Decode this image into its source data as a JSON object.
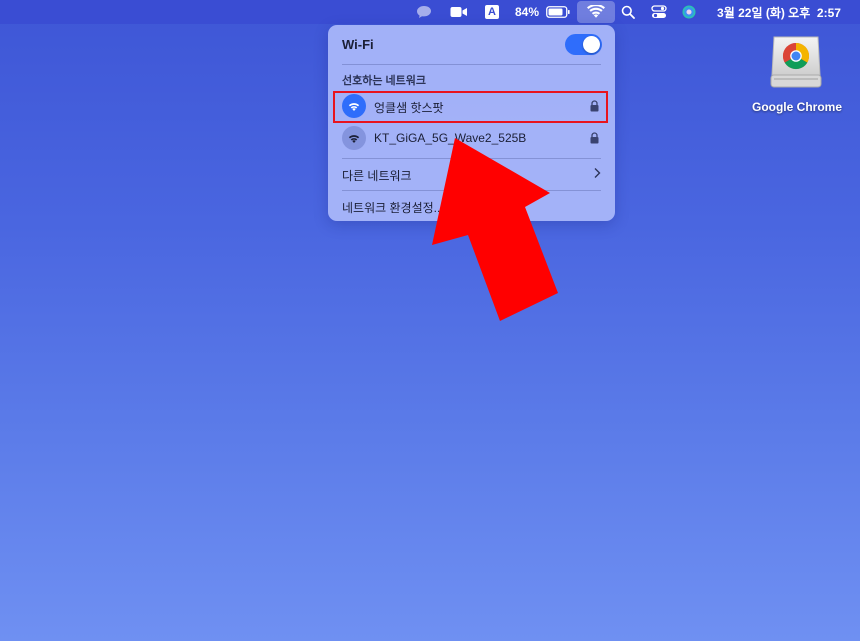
{
  "menubar": {
    "battery_percent": "84%",
    "input_source": "A",
    "clock": "3월 22일 (화) 오후  2:57"
  },
  "wifi_panel": {
    "title": "Wi-Fi",
    "wifi_enabled": true,
    "section_label": "선호하는 네트워크",
    "networks": [
      {
        "name": "엉클샘 핫스팟",
        "connected": true,
        "secured": true
      },
      {
        "name": "KT_GiGA_5G_Wave2_525B",
        "connected": false,
        "secured": true
      }
    ],
    "other_networks_label": "다른 네트워크",
    "preferences_label": "네트워크 환경설정..."
  },
  "desktop": {
    "icon_label": "Google Chrome"
  },
  "colors": {
    "accent": "#2f6dfb",
    "highlight": "#e8141f",
    "arrow": "#ff0000"
  }
}
